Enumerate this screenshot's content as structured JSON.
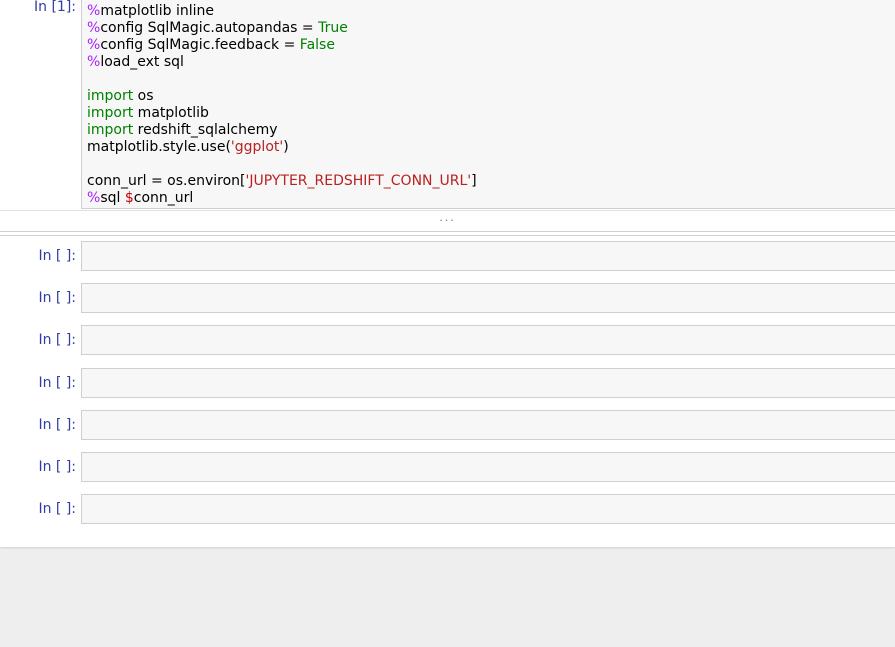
{
  "cells": [
    {
      "prompt": "In [1]:",
      "lines": [
        [
          {
            "t": "%",
            "c": "kw-magic"
          },
          {
            "t": "matplotlib inline",
            "c": ""
          }
        ],
        [
          {
            "t": "%",
            "c": "kw-magic"
          },
          {
            "t": "config SqlMagic.autopandas = ",
            "c": ""
          },
          {
            "t": "True",
            "c": "kw-green"
          }
        ],
        [
          {
            "t": "%",
            "c": "kw-magic"
          },
          {
            "t": "config SqlMagic.feedback = ",
            "c": ""
          },
          {
            "t": "False",
            "c": "kw-green"
          }
        ],
        [
          {
            "t": "%",
            "c": "kw-magic"
          },
          {
            "t": "load_ext sql",
            "c": ""
          }
        ],
        [],
        [
          {
            "t": "import",
            "c": "kw-green"
          },
          {
            "t": " os",
            "c": ""
          }
        ],
        [
          {
            "t": "import",
            "c": "kw-green"
          },
          {
            "t": " matplotlib",
            "c": ""
          }
        ],
        [
          {
            "t": "import",
            "c": "kw-green"
          },
          {
            "t": " redshift_sqlalchemy",
            "c": ""
          }
        ],
        [
          {
            "t": "matplotlib.style.use(",
            "c": ""
          },
          {
            "t": "'ggplot'",
            "c": "kw-string"
          },
          {
            "t": ")",
            "c": ""
          }
        ],
        [],
        [
          {
            "t": "conn_url = os.environ[",
            "c": ""
          },
          {
            "t": "'JUPYTER_REDSHIFT_CONN_URL'",
            "c": "kw-string"
          },
          {
            "t": "]",
            "c": ""
          }
        ],
        [
          {
            "t": "%",
            "c": "kw-magic"
          },
          {
            "t": "sql ",
            "c": ""
          },
          {
            "t": "$",
            "c": "kw-dollar"
          },
          {
            "t": "conn_url",
            "c": ""
          }
        ]
      ]
    }
  ],
  "collapsed_output": "...",
  "empty_cells": [
    {
      "prompt": "In [ ]:"
    },
    {
      "prompt": "In [ ]:"
    },
    {
      "prompt": "In [ ]:"
    },
    {
      "prompt": "In [ ]:"
    },
    {
      "prompt": "In [ ]:"
    },
    {
      "prompt": "In [ ]:"
    },
    {
      "prompt": "In [ ]:"
    }
  ],
  "colors": {
    "prompt": "#303f9f",
    "magic": "#aa22ff",
    "keyword": "#008000",
    "string": "#ba2121",
    "variable": "#cc0000",
    "cell_bg": "#f7f7f7",
    "cell_border": "#cfcfcf",
    "page_bg": "#eeeeee"
  }
}
